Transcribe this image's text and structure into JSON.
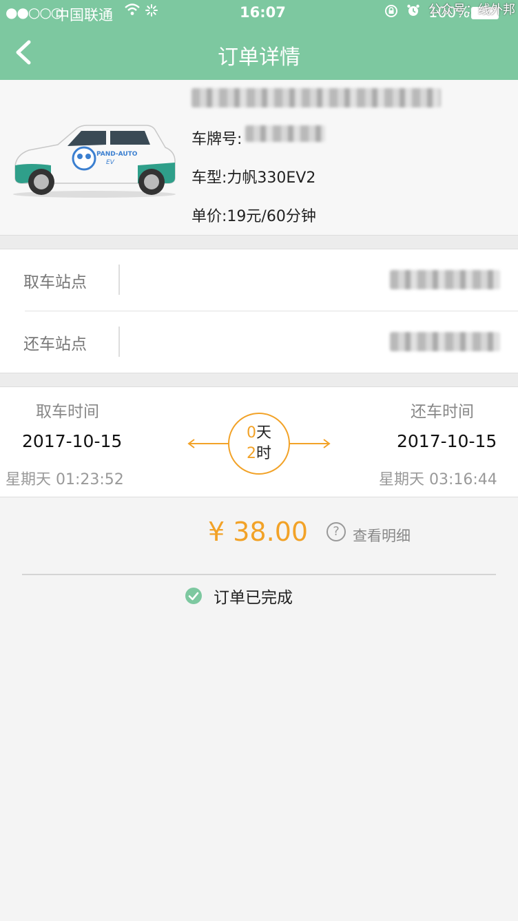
{
  "status_bar": {
    "signal": "●●○○○",
    "carrier": "中国联通",
    "time": "16:07",
    "battery": "100%",
    "watermark": "公众号：线外邦"
  },
  "header": {
    "title": "订单详情"
  },
  "car": {
    "plate_label": "车牌号:",
    "model_text": "车型:力帆330EV2",
    "price_text": "单价:19元/60分钟"
  },
  "stations": {
    "pickup_label": "取车站点",
    "return_label": "还车站点"
  },
  "times": {
    "pickup_label": "取车时间",
    "pickup_date": "2017-10-15",
    "pickup_weekday_time": "星期天   01:23:52",
    "return_label": "还车时间",
    "return_date": "2017-10-15",
    "return_weekday_time": "星期天   03:16:44",
    "duration_days": "0",
    "days_unit": "天",
    "duration_hours": "2",
    "hours_unit": "时"
  },
  "payment": {
    "amount": "¥ 38.00",
    "detail_label": "查看明细",
    "help_glyph": "?"
  },
  "order_status": {
    "text": "订单已完成"
  },
  "colors": {
    "header_bg": "#7dc8a0",
    "accent_orange": "#f2a227",
    "check_green": "#7dc8a0"
  }
}
